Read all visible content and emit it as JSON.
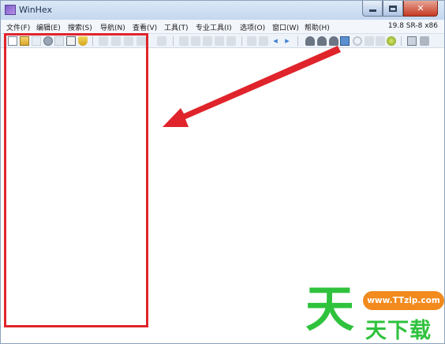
{
  "window": {
    "title": "WinHex",
    "icon": "winhex-app-icon",
    "buttons": {
      "minimize": "minimize-icon",
      "maximize": "maximize-icon",
      "close": "close-icon"
    },
    "close_glyph": "✕"
  },
  "menu": {
    "items": [
      "文件(F)",
      "编辑(E)",
      "搜索(S)",
      "导航(N)",
      "查看(V)",
      "工具(T)",
      "专业工具(I)",
      "选项(O)",
      "窗口(W)",
      "帮助(H)"
    ],
    "version": "19.8 SR-8 x86"
  },
  "toolbar": {
    "icons": [
      "new-file-icon",
      "open-file-icon",
      "save-icon",
      "gear-icon",
      "print-icon",
      "properties-icon",
      "pin-icon",
      "undo-icon",
      "copy-icon",
      "paste-icon",
      "cut-icon",
      "clipboard-icon",
      "find-icon",
      "find-hex-icon",
      "replace-icon",
      "replace-hex-icon",
      "goto-icon",
      "back-arrow-icon",
      "forward-arrow-icon",
      "nav-left-icon",
      "nav-right-icon",
      "open-disk-icon",
      "snapshot-icon",
      "clone-disk-icon",
      "disk-editor-icon",
      "search-icon",
      "zoom-icon",
      "zoom-small-icon",
      "green-ball-icon",
      "calculator-icon",
      "grid-icon"
    ]
  },
  "annotation": {
    "frame_color": "#e0242b",
    "arrow_color": "#e0242b"
  },
  "watermark": {
    "glyph": "天",
    "url": "www.TTzip.com",
    "text": "天下载",
    "colors": {
      "green": "#2fc23d",
      "orange": "#f28a1e"
    }
  }
}
